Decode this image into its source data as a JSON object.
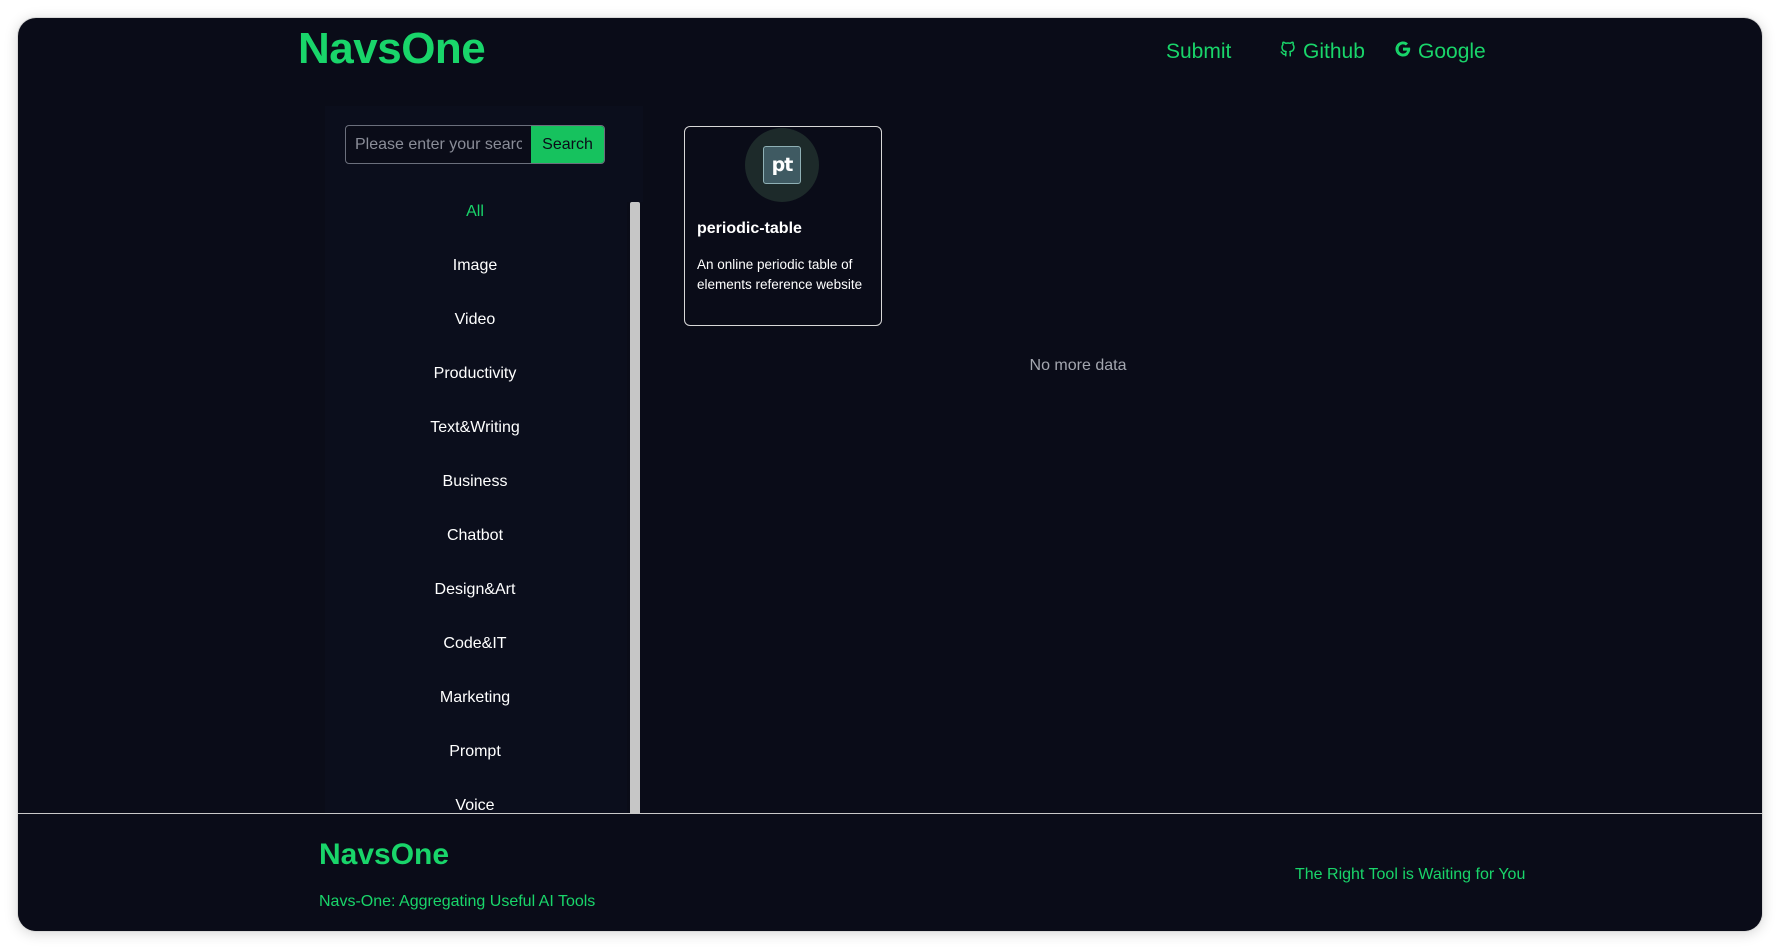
{
  "header": {
    "logo": "NavsOne",
    "nav": {
      "submit": "Submit",
      "github": "Github",
      "google": "Google"
    }
  },
  "sidebar": {
    "search": {
      "placeholder": "Please enter your search",
      "value": "",
      "button_label": "Search"
    },
    "categories": [
      {
        "label": "All",
        "active": true
      },
      {
        "label": "Image"
      },
      {
        "label": "Video"
      },
      {
        "label": "Productivity"
      },
      {
        "label": "Text&Writing"
      },
      {
        "label": "Business"
      },
      {
        "label": "Chatbot"
      },
      {
        "label": "Design&Art"
      },
      {
        "label": "Code&IT"
      },
      {
        "label": "Marketing"
      },
      {
        "label": "Prompt"
      },
      {
        "label": "Voice"
      }
    ]
  },
  "main": {
    "cards": [
      {
        "icon_text": "pt",
        "title": "periodic-table",
        "description": "An online periodic table of elements reference website"
      }
    ],
    "status": "No more data"
  },
  "footer": {
    "logo": "NavsOne",
    "tagline": "Navs-One: Aggregating Useful AI Tools",
    "slogan": "The Right Tool is Waiting for You"
  },
  "colors": {
    "accent": "#19d56a",
    "background": "#0a0c18",
    "button": "#16c25e"
  },
  "icons": {
    "github": "github-icon",
    "google": "google-icon"
  }
}
